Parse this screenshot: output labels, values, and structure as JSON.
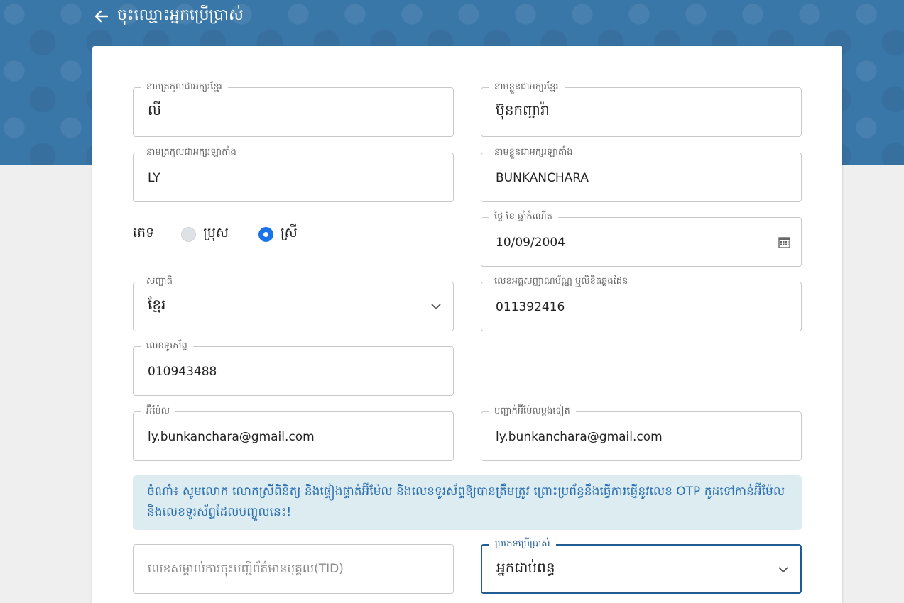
{
  "header": {
    "back_icon": "arrow-left-icon",
    "title": "ចុះឈ្មោះអ្នកប្រើប្រាស់"
  },
  "form": {
    "family_name_kh": {
      "label": "នាមត្រកូលជាអក្សរខ្មែរ",
      "value": "លី"
    },
    "given_name_kh": {
      "label": "នាមខ្លួនជាអក្សរខ្មែរ",
      "value": "ប៊ុនកញ្ចារ៉ា"
    },
    "family_name_latin": {
      "label": "នាមត្រកូលជាអក្សរឡាតាំង",
      "value": "LY"
    },
    "given_name_latin": {
      "label": "នាមខ្លួនជាអក្សរឡាតាំង",
      "value": "BUNKANCHARA"
    },
    "gender": {
      "label": "ភេទ",
      "options": [
        {
          "label": "ប្រុស",
          "checked": false
        },
        {
          "label": "ស្រី",
          "checked": true
        }
      ]
    },
    "dob": {
      "label": "ថ្ងៃ ខែ ឆ្នាំកំណើត",
      "value": "10/09/2004",
      "icon": "calendar-icon"
    },
    "nationality": {
      "label": "សញ្ជាតិ",
      "value": "ខ្មែរ",
      "icon": "chevron-down-icon"
    },
    "id_number": {
      "label": "លេខអត្តសញ្ញាណប័ណ្ណ ឬលិខិតឆ្លងដែន",
      "value": "011392416"
    },
    "phone": {
      "label": "លេខទូរស័ព្ទ",
      "value": "010943488"
    },
    "email": {
      "label": "អ៊ីម៉ែល",
      "value": "ly.bunkanchara@gmail.com"
    },
    "email_confirm": {
      "label": "បញ្ជាក់អ៊ីម៉ែលម្តងទៀត",
      "value": "ly.bunkanchara@gmail.com"
    },
    "notice": "ចំណាំ៖ សូមលោក លោកស្រីពិនិត្យ និងផ្ទៀងផ្ទាត់អ៊ីម៉ែល និងលេខទូរស័ព្ទឱ្យបានត្រឹមត្រូវ ព្រោះប្រព័ន្ធនឹងធ្វើការផ្ញើនូវលេខ OTP កូដទៅកាន់អ៊ីម៉ែល និងលេខទូរស័ព្ទដែលបញ្ចូលនេះ!",
    "tid": {
      "placeholder": "លេខសម្គាល់ការចុះបញ្ជីព័ត៌មានបុគ្គល(TID)"
    },
    "user_type": {
      "label": "ប្រភេទប្រើប្រាស់",
      "value": "អ្នកជាប់ពន្ធ",
      "icon": "chevron-down-icon"
    }
  },
  "colors": {
    "banner": "#3a77a9",
    "accent": "#1a73e8",
    "focus_border": "#1f5c93",
    "notice_bg": "#dcecf1",
    "notice_text": "#2b6fb0"
  }
}
